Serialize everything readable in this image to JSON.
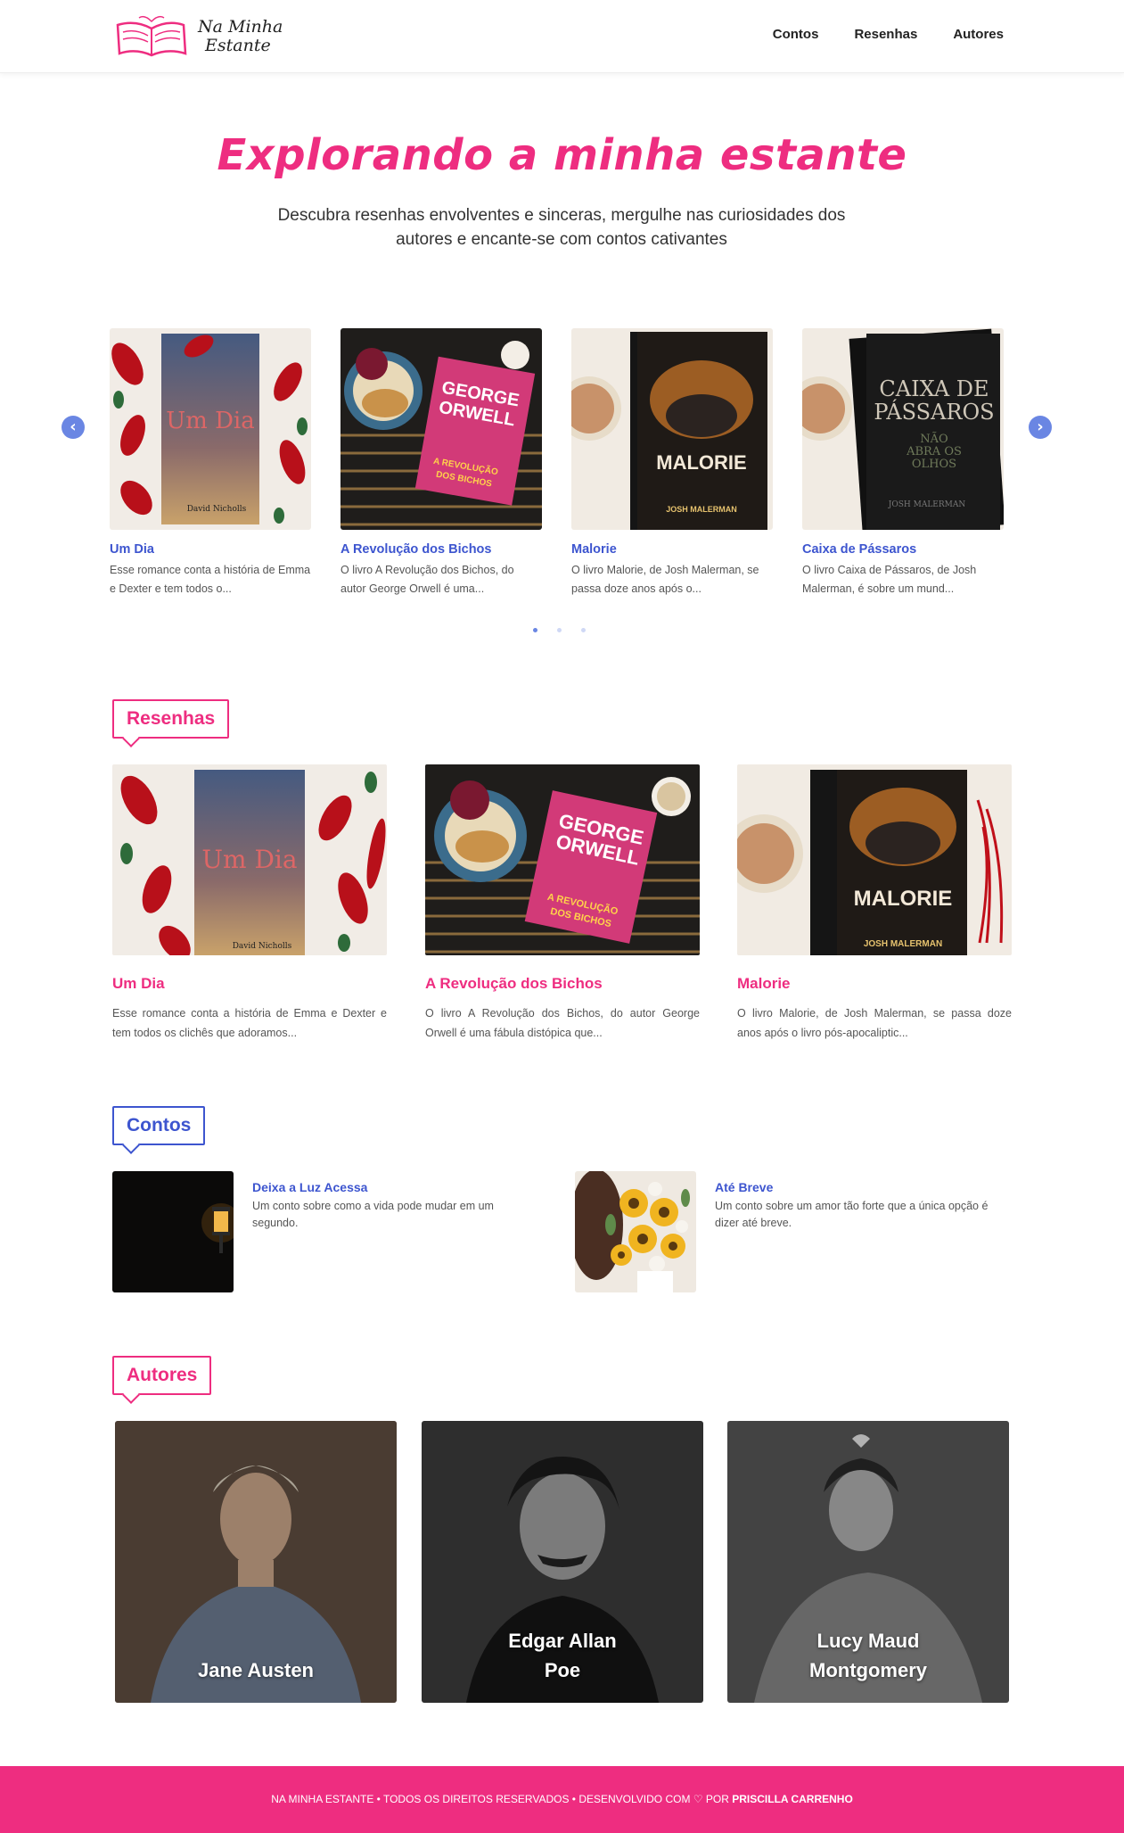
{
  "brand": {
    "line1": "Na Minha",
    "line2": "Estante",
    "accent": "#ee2d80",
    "secondary": "#3d55cf"
  },
  "nav": [
    {
      "label": "Contos"
    },
    {
      "label": "Resenhas"
    },
    {
      "label": "Autores"
    }
  ],
  "hero": {
    "title": "Explorando a minha estante",
    "subtitle": "Descubra resenhas envolventes e sinceras, mergulhe nas curiosidades dos autores e encante-se com contos cativantes"
  },
  "carousel": {
    "prev_icon": "chevron-left-icon",
    "next_icon": "chevron-right-icon",
    "pages": 3,
    "active_page": 1,
    "items": [
      {
        "title": "Um Dia",
        "desc": "Esse romance conta a história de Emma e Dexter e tem todos o..."
      },
      {
        "title": "A Revolução dos Bichos",
        "desc": "O livro A Revolução dos Bichos, do autor George Orwell é uma..."
      },
      {
        "title": "Malorie",
        "desc": "O livro Malorie, de Josh Malerman, se passa doze anos após o..."
      },
      {
        "title": "Caixa de Pássaros",
        "desc": "O livro Caixa de Pássaros, de Josh Malerman, é sobre um mund..."
      }
    ]
  },
  "sections": {
    "resenhas": "Resenhas",
    "contos": "Contos",
    "autores": "Autores"
  },
  "resenhas": [
    {
      "title": "Um Dia",
      "desc": "Esse romance conta a história de Emma e Dexter e tem todos os clichês que adoramos..."
    },
    {
      "title": "A Revolução dos Bichos",
      "desc": "O livro A Revolução dos Bichos, do autor George Orwell é uma fábula distópica que..."
    },
    {
      "title": "Malorie",
      "desc": "O livro Malorie, de Josh Malerman, se passa doze anos após o livro pós-apocaliptic..."
    }
  ],
  "contos": [
    {
      "title": "Deixa a Luz Acessa",
      "desc": "Um conto sobre como a vida pode mudar em um segundo."
    },
    {
      "title": "Até Breve",
      "desc": "Um conto sobre um amor tão forte que a única opção é dizer até breve."
    }
  ],
  "autores": [
    {
      "name": "Jane Austen"
    },
    {
      "name": "Edgar Allan Poe"
    },
    {
      "name": "Lucy Maud Montgomery"
    }
  ],
  "footer": {
    "text": "NA MINHA ESTANTE • TODOS OS DIREITOS RESERVADOS • DESENVOLVIDO COM ♡ POR",
    "author": "PRISCILLA CARRENHO"
  },
  "cover_text": {
    "um_dia": "Um Dia",
    "david": "David Nicholls",
    "george_orwell_1": "GEORGE",
    "george_orwell_2": "ORWELL",
    "revolucao_1": "A REVOLUÇÃO",
    "revolucao_2": "DOS BICHOS",
    "malorie": "MALORIE",
    "josh": "JOSH MALERMAN",
    "caixa_1": "CAIXA DE",
    "caixa_2": "PÁSSAROS",
    "caixa_3": "NÃO",
    "caixa_4": "ABRA OS",
    "caixa_5": "OLHOS"
  }
}
